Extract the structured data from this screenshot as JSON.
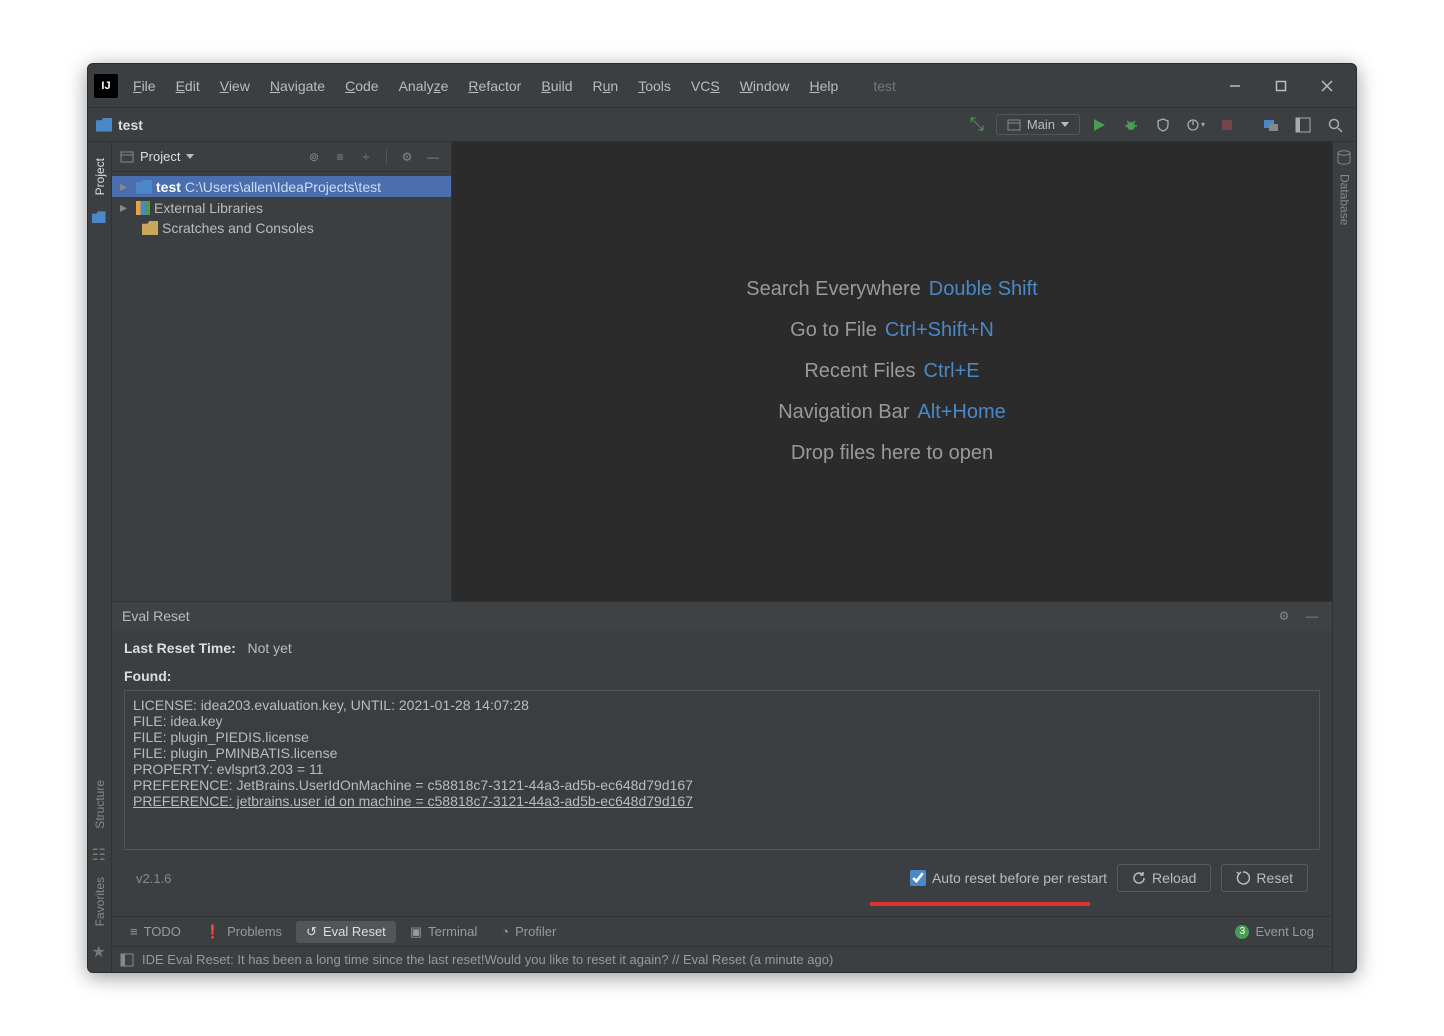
{
  "title_context": "test",
  "menu": [
    "File",
    "Edit",
    "View",
    "Navigate",
    "Code",
    "Analyze",
    "Refactor",
    "Build",
    "Run",
    "Tools",
    "VCS",
    "Window",
    "Help"
  ],
  "breadcrumb": "test",
  "run_configuration": "Main",
  "project_pane": {
    "title": "Project",
    "tree": {
      "root_name": "test",
      "root_path": "C:\\Users\\allen\\IdeaProjects\\test",
      "external_libs": "External Libraries",
      "scratches": "Scratches and Consoles"
    }
  },
  "editor_hints": {
    "search_everywhere": {
      "label": "Search Everywhere",
      "kb": "Double Shift"
    },
    "go_to_file": {
      "label": "Go to File",
      "kb": "Ctrl+Shift+N"
    },
    "recent_files": {
      "label": "Recent Files",
      "kb": "Ctrl+E"
    },
    "nav_bar": {
      "label": "Navigation Bar",
      "kb": "Alt+Home"
    },
    "drop": "Drop files here to open"
  },
  "eval_reset": {
    "panel_title": "Eval Reset",
    "last_reset_label": "Last Reset Time:",
    "last_reset_value": "Not yet",
    "found_label": "Found:",
    "listing": [
      "LICENSE: idea203.evaluation.key, UNTIL: 2021-01-28 14:07:28",
      "FILE: idea.key",
      "FILE: plugin_PIEDIS.license",
      "FILE: plugin_PMINBATIS.license",
      "PROPERTY: evlsprt3.203 = 11",
      "PREFERENCE: JetBrains.UserIdOnMachine = c58818c7-3121-44a3-ad5b-ec648d79d167",
      "PREFERENCE: jetbrains.user id on machine = c58818c7-3121-44a3-ad5b-ec648d79d167"
    ],
    "version": "v2.1.6",
    "auto_reset_label": "Auto reset before per restart",
    "reload_label": "Reload",
    "reset_label": "Reset"
  },
  "bottom_tabs": {
    "todo": "TODO",
    "problems": "Problems",
    "eval_reset": "Eval Reset",
    "terminal": "Terminal",
    "profiler": "Profiler",
    "event_log": "Event Log"
  },
  "right_gutter_label": "Database",
  "left_gutter_labels": {
    "project": "Project",
    "structure": "Structure",
    "favorites": "Favorites"
  },
  "status_message": "IDE Eval Reset: It has been a long time since the last reset!Would you like to reset it again? // Eval Reset (a minute ago)"
}
